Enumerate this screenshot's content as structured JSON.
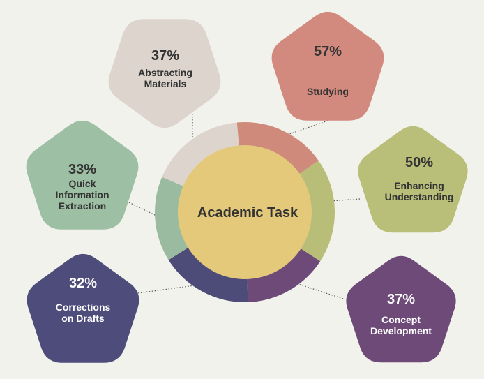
{
  "center": {
    "label": "Academic Task",
    "color": "#e4c97a"
  },
  "ring_colors": [
    "#cf8a7c",
    "#b8bd78",
    "#6e4a79",
    "#4d4b78",
    "#9bbba0",
    "#ddd5cd"
  ],
  "items": [
    {
      "id": "studying",
      "percent": "57%",
      "lines": [
        "Studying"
      ],
      "color": "#d38a7e",
      "text_color": "#333333"
    },
    {
      "id": "enhancing-understanding",
      "percent": "50%",
      "lines": [
        "Enhancing",
        "Understanding"
      ],
      "color": "#b9bf78",
      "text_color": "#333333"
    },
    {
      "id": "concept-development",
      "percent": "37%",
      "lines": [
        "Concept",
        "Development"
      ],
      "color": "#6e4a79",
      "text_color": "#ffffff"
    },
    {
      "id": "corrections-on-drafts",
      "percent": "32%",
      "lines": [
        "Corrections",
        "on Drafts"
      ],
      "color": "#4e4c7b",
      "text_color": "#ffffff"
    },
    {
      "id": "quick-information-extraction",
      "percent": "33%",
      "lines": [
        "Quick",
        "Information",
        "Extraction"
      ],
      "color": "#9dbfa3",
      "text_color": "#333333"
    },
    {
      "id": "abstracting-materials",
      "percent": "37%",
      "lines": [
        "Abstracting",
        "Materials"
      ],
      "color": "#ddd5cd",
      "text_color": "#333333"
    }
  ]
}
